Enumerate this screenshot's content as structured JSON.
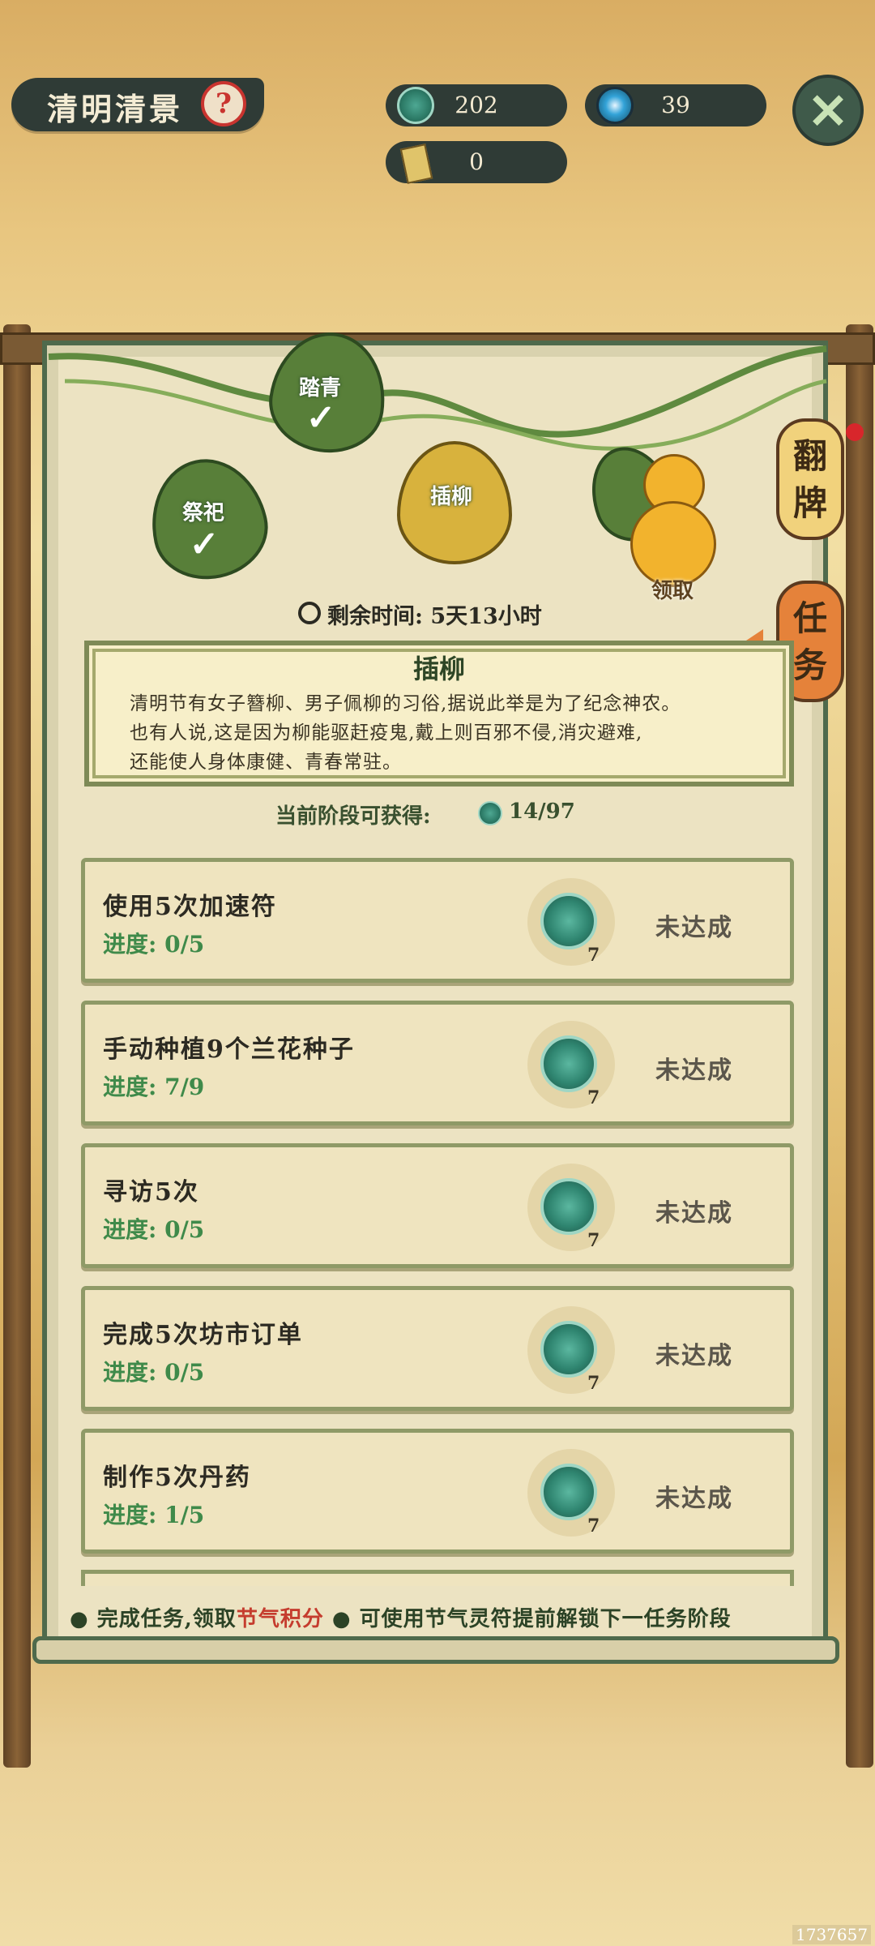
{
  "header": {
    "title": "清明清景",
    "help_glyph": "?",
    "resources": [
      {
        "icon": "jade-coin-icon",
        "value": "202"
      },
      {
        "icon": "spirit-orb-icon",
        "value": "39"
      },
      {
        "icon": "talisman-icon",
        "value": "0"
      }
    ],
    "close_glyph": "✕"
  },
  "stages": [
    {
      "label": "祭祀",
      "done": true
    },
    {
      "label": "踏青",
      "done": true
    },
    {
      "label": "插柳",
      "done": false
    },
    {
      "label": "领取",
      "reward": "gourd-icon"
    }
  ],
  "side_tabs": {
    "flip": "翻牌",
    "tasks": "任务"
  },
  "timer": "剩余时间: 5天13小时",
  "info": {
    "title": "插柳",
    "lines": [
      "清明节有女子簪柳、男子佩柳的习俗,据说此举是为了纪念神农。",
      "也有人说,这是因为柳能驱赶疫鬼,戴上则百邪不侵,消灾避难,",
      "还能使人身体康健、青春常驻。"
    ]
  },
  "stage_reward": {
    "label": "当前阶段可获得:",
    "value": "14/97"
  },
  "tasks": [
    {
      "name": "使用5次加速符",
      "progress": "进度: 0/5",
      "reward_qty": "7",
      "status": "未达成"
    },
    {
      "name": "手动种植9个兰花种子",
      "progress": "进度: 7/9",
      "reward_qty": "7",
      "status": "未达成"
    },
    {
      "name": "寻访5次",
      "progress": "进度: 0/5",
      "reward_qty": "7",
      "status": "未达成"
    },
    {
      "name": "完成5次坊市订单",
      "progress": "进度: 0/5",
      "reward_qty": "7",
      "status": "未达成"
    },
    {
      "name": "制作5次丹药",
      "progress": "进度: 1/5",
      "reward_qty": "7",
      "status": "未达成"
    }
  ],
  "footer": {
    "bullet": "●",
    "part1": "完成任务,领取",
    "highlight": "节气积分",
    "part2": "可使用节气灵符提前解锁下一任务阶段"
  },
  "watermark": "1737657",
  "colors": {
    "accent": "#3f8a4a",
    "highlight": "#c53c2e",
    "frame": "#4f6a4c"
  }
}
